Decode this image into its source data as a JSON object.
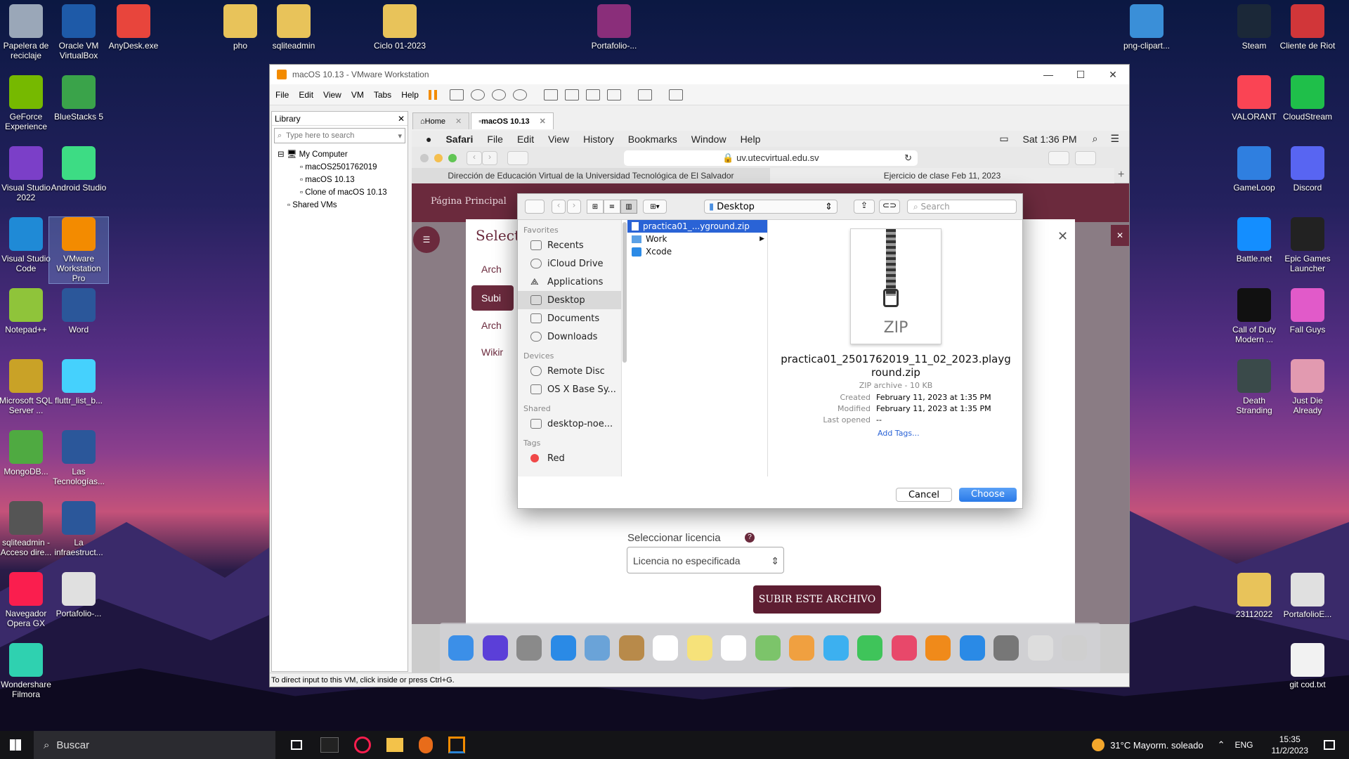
{
  "desktop": {
    "left": [
      {
        "label": "Papelera de reciclaje",
        "icon": "recycle-bin-icon",
        "color": "#9aa7b8"
      },
      {
        "label": "Oracle VM VirtualBox",
        "icon": "virtualbox-icon",
        "color": "#1e5aa8"
      },
      {
        "label": "AnyDesk.exe",
        "icon": "anydesk-icon",
        "color": "#e8453c"
      },
      {
        "label": "GeForce Experience",
        "icon": "geforce-icon",
        "color": "#76b900"
      },
      {
        "label": "BlueStacks 5",
        "icon": "bluestacks-icon",
        "color": "#3aa34a"
      },
      {
        "label": "Visual Studio 2022",
        "icon": "visual-studio-icon",
        "color": "#7b3fc8"
      },
      {
        "label": "Android Studio",
        "icon": "android-studio-icon",
        "color": "#3ddc84"
      },
      {
        "label": "Visual Studio Code",
        "icon": "vscode-icon",
        "color": "#1f8ad6"
      },
      {
        "label": "VMware Workstation Pro",
        "icon": "vmware-icon",
        "color": "#f38b00"
      },
      {
        "label": "Notepad++",
        "icon": "notepadpp-icon",
        "color": "#8fc43a"
      },
      {
        "label": "Word",
        "icon": "word-icon",
        "color": "#2b579a"
      },
      {
        "label": "Microsoft SQL Server ...",
        "icon": "sql-server-icon",
        "color": "#c9a227"
      },
      {
        "label": "fluttr_list_b...",
        "icon": "flutter-icon",
        "color": "#45d1fd"
      },
      {
        "label": "MongoDB...",
        "icon": "mongodb-icon",
        "color": "#4faa41"
      },
      {
        "label": "Las Tecnologías...",
        "icon": "word-doc-icon",
        "color": "#2b579a"
      },
      {
        "label": "sqliteadmin - Acceso dire...",
        "icon": "sqliteadmin-icon",
        "color": "#555"
      },
      {
        "label": "La infraestruct...",
        "icon": "word-doc-icon",
        "color": "#2b579a"
      },
      {
        "label": "Navegador Opera GX",
        "icon": "opera-gx-icon",
        "color": "#fa1e4e"
      },
      {
        "label": "Portafolio-...",
        "icon": "pdf-icon",
        "color": "#e0e0e0"
      },
      {
        "label": "Wondershare Filmora",
        "icon": "filmora-icon",
        "color": "#2fd1b0"
      }
    ],
    "top": [
      {
        "label": "pho",
        "icon": "folder-icon",
        "color": "#e8c35a"
      },
      {
        "label": "sqliteadmin",
        "icon": "folder-icon",
        "color": "#e8c35a"
      },
      {
        "label": "Ciclo 01-2023",
        "icon": "folder-icon",
        "color": "#e8c35a"
      },
      {
        "label": "Portafolio-...",
        "icon": "winrar-icon",
        "color": "#8a2e7a"
      },
      {
        "label": "png-clipart...",
        "icon": "image-file-icon",
        "color": "#3a8fd8"
      }
    ],
    "right": [
      {
        "label": "Steam",
        "icon": "steam-icon",
        "color": "#1b2838"
      },
      {
        "label": "Cliente de Riot",
        "icon": "riot-icon",
        "color": "#d13639"
      },
      {
        "label": "VALORANT",
        "icon": "valorant-icon",
        "color": "#fa4454"
      },
      {
        "label": "CloudStream",
        "icon": "cloudstream-icon",
        "color": "#1fbf4a"
      },
      {
        "label": "GameLoop",
        "icon": "gameloop-icon",
        "color": "#2f7fe0"
      },
      {
        "label": "Discord",
        "icon": "discord-icon",
        "color": "#5865f2"
      },
      {
        "label": "Battle.net",
        "icon": "battlenet-icon",
        "color": "#148eff"
      },
      {
        "label": "Epic Games Launcher",
        "icon": "epic-icon",
        "color": "#222"
      },
      {
        "label": "Call of Duty Modern ...",
        "icon": "cod-icon",
        "color": "#111"
      },
      {
        "label": "Fall Guys",
        "icon": "fallguys-icon",
        "color": "#e15ac9"
      },
      {
        "label": "Death Stranding",
        "icon": "death-stranding-icon",
        "color": "#3a4a4a"
      },
      {
        "label": "Just Die Already",
        "icon": "jda-icon",
        "color": "#e29ab0"
      },
      {
        "label": "23112022",
        "icon": "folder-icon",
        "color": "#e8c35a"
      },
      {
        "label": "PortafolioE...",
        "icon": "pdf-icon",
        "color": "#e0e0e0"
      },
      {
        "label": "git cod.txt",
        "icon": "text-file-icon",
        "color": "#f2f2f2"
      }
    ]
  },
  "vmware": {
    "title": "macOS 10.13 - VMware Workstation",
    "menu": [
      "File",
      "Edit",
      "View",
      "VM",
      "Tabs",
      "Help"
    ],
    "library": {
      "title": "Library",
      "search_placeholder": "Type here to search",
      "tree": [
        "My Computer",
        "macOS2501762019",
        "macOS 10.13",
        "Clone of macOS 10.13",
        "Shared VMs"
      ]
    },
    "tabs": [
      "Home",
      "macOS 10.13"
    ],
    "status": "To direct input to this VM, click inside or press Ctrl+G."
  },
  "mac": {
    "menubar": [
      "Safari",
      "File",
      "Edit",
      "View",
      "History",
      "Bookmarks",
      "Window",
      "Help"
    ],
    "clock": "Sat 1:36 PM",
    "url": "uv.utecvirtual.edu.sv",
    "tabs": [
      "Dirección de Educación Virtual de la Universidad Tecnológica de El Salvador",
      "Ejercicio de clase Feb 11, 2023"
    ],
    "page": {
      "breadcrumb": "Página Principal",
      "selector_title": "Selecto",
      "menu": [
        "Arch",
        "Subi",
        "Arch",
        "Wikir"
      ],
      "license_label": "Seleccionar licencia",
      "license_value": "Licencia no especificada",
      "upload_button": "SUBIR ESTE ARCHIVO"
    }
  },
  "dialog": {
    "location": "Desktop",
    "search_placeholder": "Search",
    "sidebar": {
      "favorites_label": "Favorites",
      "favorites": [
        "Recents",
        "iCloud Drive",
        "Applications",
        "Desktop",
        "Documents",
        "Downloads"
      ],
      "devices_label": "Devices",
      "devices": [
        "Remote Disc",
        "OS X Base Sy..."
      ],
      "shared_label": "Shared",
      "shared": [
        "desktop-noe..."
      ],
      "tags_label": "Tags",
      "tags": [
        "Red"
      ]
    },
    "files": [
      "practica01_...yground.zip",
      "Work",
      "Xcode"
    ],
    "preview": {
      "badge": "ZIP",
      "filename": "practica01_2501762019_11_02_2023.playground.zip",
      "kind": "ZIP archive - 10 KB",
      "created_label": "Created",
      "created": "February 11, 2023 at 1:35 PM",
      "modified_label": "Modified",
      "modified": "February 11, 2023 at 1:35 PM",
      "opened_label": "Last opened",
      "opened": "--",
      "add_tags": "Add Tags..."
    },
    "cancel": "Cancel",
    "choose": "Choose"
  },
  "taskbar": {
    "search": "Buscar",
    "weather": "31°C  Mayorm. soleado",
    "lang": "ENG",
    "time": "15:35",
    "date": "11/2/2023"
  }
}
